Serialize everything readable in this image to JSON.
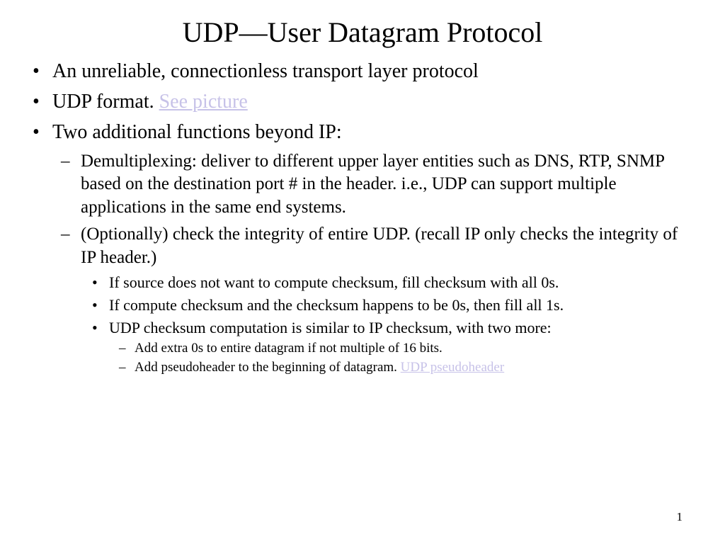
{
  "title": "UDP—User Datagram Protocol",
  "bullets": {
    "b1": "An unreliable, connectionless transport layer protocol",
    "b2_prefix": "UDP format. ",
    "b2_link": "See picture",
    "b3": "Two additional functions beyond IP:",
    "b3_1": "Demultiplexing: deliver to different upper layer entities such as DNS, RTP, SNMP based on the destination port # in the header. i.e., UDP can support multiple applications in the same end systems.",
    "b3_2": "(Optionally) check the integrity of entire UDP. (recall IP only checks the integrity of IP header.)",
    "b3_2_1": "If source does not want to compute checksum, fill checksum with all 0s.",
    "b3_2_2": "If compute checksum and the checksum happens to be 0s, then fill all 1s.",
    "b3_2_3": "UDP checksum computation is similar to IP checksum, with two more:",
    "b3_2_3_1": "Add extra 0s to entire datagram if not multiple of 16 bits.",
    "b3_2_3_2_prefix": "Add pseudoheader to the beginning of datagram.   ",
    "b3_2_3_2_link": "UDP pseudoheader"
  },
  "page_number": "1",
  "links": {
    "see_picture_href": "#",
    "pseudoheader_href": "#"
  }
}
